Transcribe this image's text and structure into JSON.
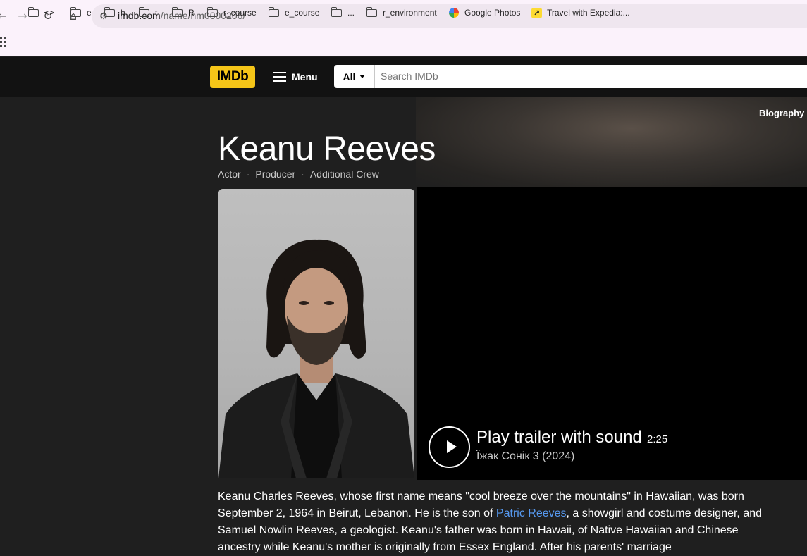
{
  "browser": {
    "url_host": "imdb.com",
    "url_path": "/name/nm0000206/",
    "bookmarks": [
      {
        "label": "<>",
        "icon": "folder-icon"
      },
      {
        "label": "e",
        "icon": "folder-icon"
      },
      {
        "label": "h",
        "icon": "folder-icon"
      },
      {
        "label": "t",
        "icon": "folder-icon"
      },
      {
        "label": "R",
        "icon": "folder-icon"
      },
      {
        "label": "r_course",
        "icon": "folder-icon"
      },
      {
        "label": "e_course",
        "icon": "folder-icon"
      },
      {
        "label": "...",
        "icon": "folder-icon"
      },
      {
        "label": "r_environment",
        "icon": "folder-icon"
      },
      {
        "label": "Google Photos",
        "icon": "google-photos-icon"
      },
      {
        "label": "Travel with Expedia:...",
        "icon": "expedia-icon"
      }
    ]
  },
  "header": {
    "logo": "IMDb",
    "menu_label": "Menu",
    "search_category": "All",
    "search_placeholder": "Search IMDb"
  },
  "hero": {
    "biography_link": "Biography",
    "name": "Keanu Reeves",
    "roles": [
      "Actor",
      "Producer",
      "Additional Crew"
    ]
  },
  "trailer": {
    "title": "Play trailer with sound",
    "duration": "2:25",
    "subtitle": "Їжак Сонік 3 (2024)"
  },
  "bio": {
    "part1": "Keanu Charles Reeves, whose first name means \"cool breeze over the mountains\" in Hawaiian, was born September 2, 1964 in Beirut, Lebanon. He is the son of ",
    "link": "Patric Reeves",
    "part2": ", a showgirl and costume designer, and Samuel Nowlin Reeves, a geologist. Keanu's father was born in Hawaii, of Native Hawaiian and Chinese ancestry while Keanu's mother is originally from Essex England. After his parents' marriage"
  },
  "colors": {
    "imdb_yellow": "#f5c518",
    "background": "#1f1f1f",
    "header": "#121212",
    "link": "#5799ef"
  }
}
